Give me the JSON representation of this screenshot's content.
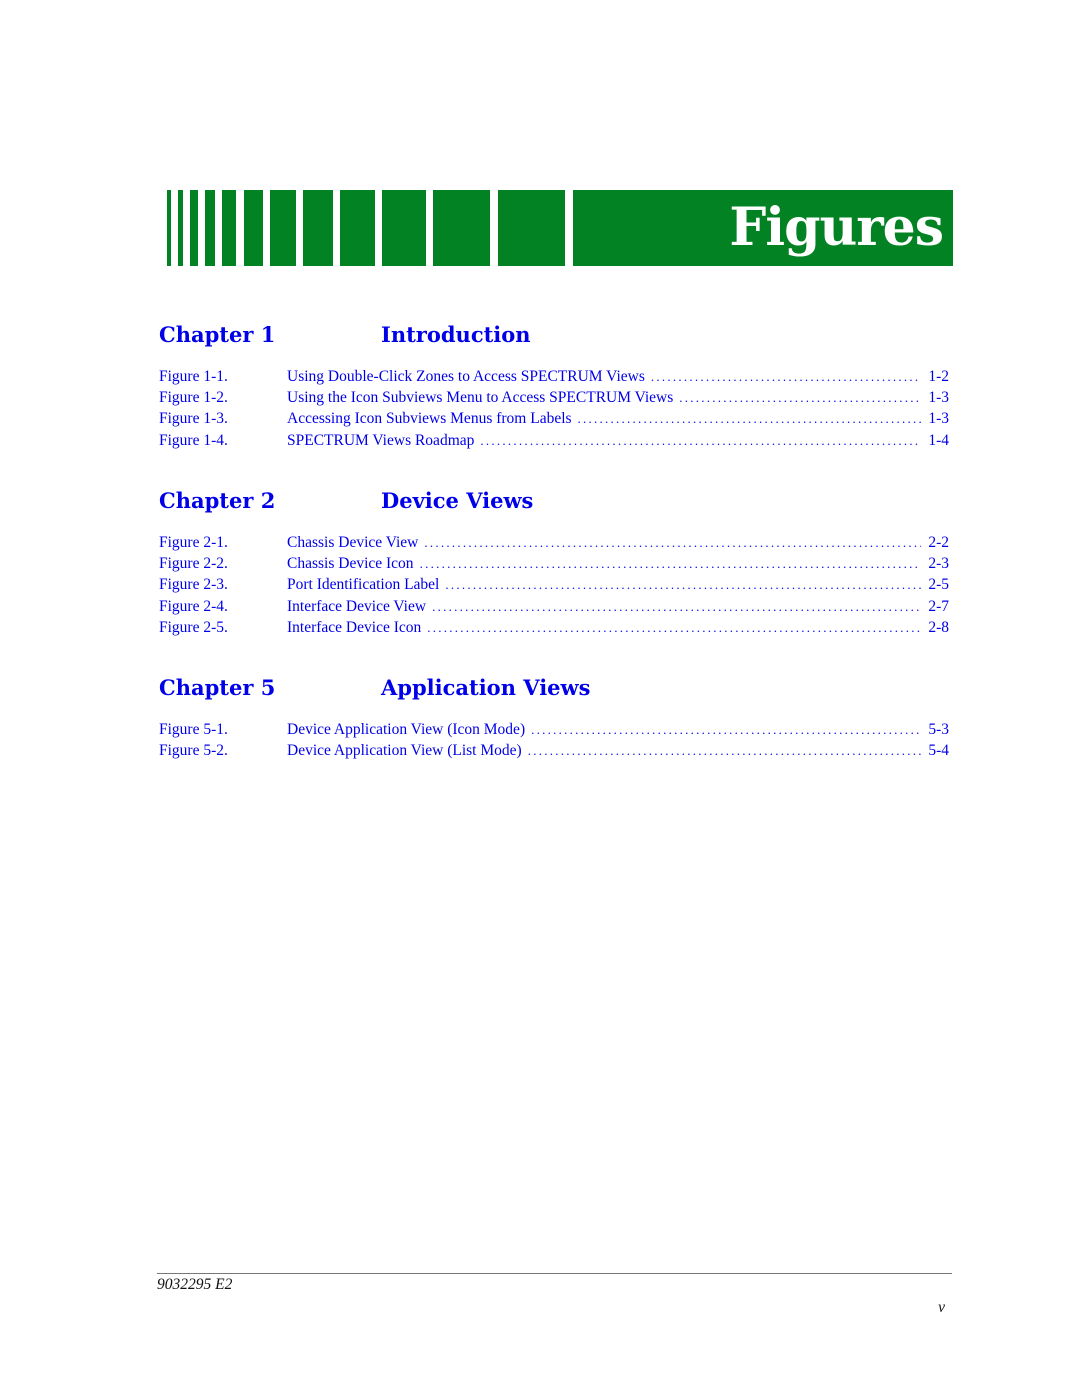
{
  "banner": {
    "title": "Figures",
    "color": "#028223"
  },
  "chapters": [
    {
      "label": "Chapter 1",
      "title": "Introduction",
      "entries": [
        {
          "figure": "Figure 1-1.",
          "title": "Using Double-Click Zones to Access SPECTRUM Views",
          "page": "1-2"
        },
        {
          "figure": "Figure 1-2.",
          "title": "Using the Icon Subviews Menu to Access SPECTRUM Views",
          "page": "1-3"
        },
        {
          "figure": "Figure 1-3.",
          "title": "Accessing Icon Subviews Menus from Labels",
          "page": "1-3"
        },
        {
          "figure": "Figure 1-4.",
          "title": "SPECTRUM Views Roadmap",
          "page": "1-4"
        }
      ]
    },
    {
      "label": "Chapter 2",
      "title": "Device Views",
      "entries": [
        {
          "figure": "Figure 2-1.",
          "title": "Chassis Device View",
          "page": "2-2"
        },
        {
          "figure": "Figure 2-2.",
          "title": "Chassis Device Icon",
          "page": "2-3"
        },
        {
          "figure": "Figure 2-3.",
          "title": "Port Identification Label",
          "page": "2-5"
        },
        {
          "figure": "Figure 2-4.",
          "title": "Interface Device View",
          "page": "2-7"
        },
        {
          "figure": "Figure 2-5.",
          "title": "Interface Device Icon",
          "page": "2-8"
        }
      ]
    },
    {
      "label": "Chapter 5",
      "title": "Application Views",
      "entries": [
        {
          "figure": "Figure 5-1.",
          "title": "Device Application View (Icon Mode)",
          "page": "5-3"
        },
        {
          "figure": "Figure 5-2.",
          "title": "Device Application View (List Mode)",
          "page": "5-4"
        }
      ]
    }
  ],
  "footer": {
    "doc_id": "9032295 E2",
    "page_number": "v"
  }
}
